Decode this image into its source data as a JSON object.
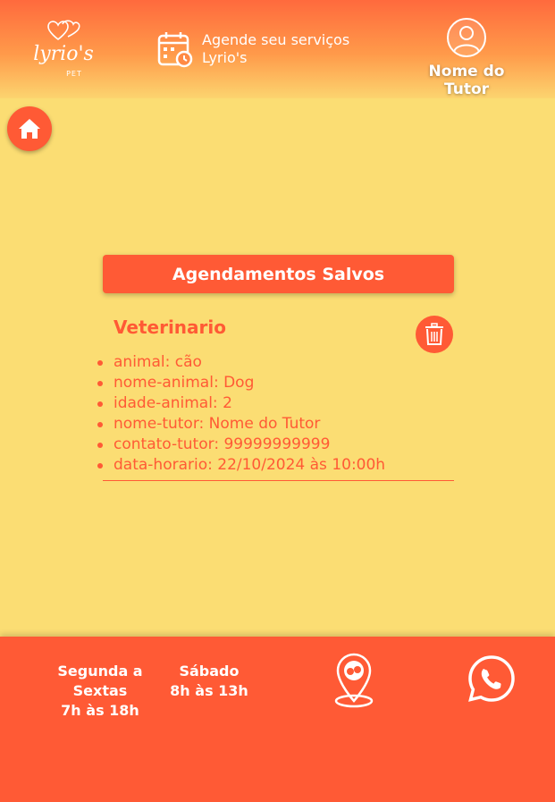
{
  "header": {
    "logo": {
      "name": "lyrio's",
      "sub": "PET"
    },
    "schedule_link": "Agende seu serviços Lyrio's",
    "tutor_name": "Nome do Tutor"
  },
  "main": {
    "section_title": "Agendamentos Salvos",
    "appointment": {
      "service": "Veterinario",
      "details": [
        "animal: cão",
        "nome-animal: Dog",
        "idade-animal: 2",
        "nome-tutor: Nome do Tutor",
        "contato-tutor: 99999999999",
        "data-horario: 22/10/2024 às 10:00h"
      ]
    }
  },
  "footer": {
    "weekdays_label": "Segunda a Sextas",
    "weekdays_hours": "7h às 18h",
    "saturday_label": "Sábado",
    "saturday_hours": "8h às 13h"
  },
  "icons": {
    "home": "home-icon",
    "calendar": "calendar-clock-icon",
    "avatar": "user-icon",
    "delete": "trash-icon",
    "location": "map-pin-icon",
    "whatsapp": "whatsapp-icon"
  },
  "colors": {
    "primary": "#ff5a35",
    "background": "#fbdd73",
    "text_light": "#ffffff"
  }
}
